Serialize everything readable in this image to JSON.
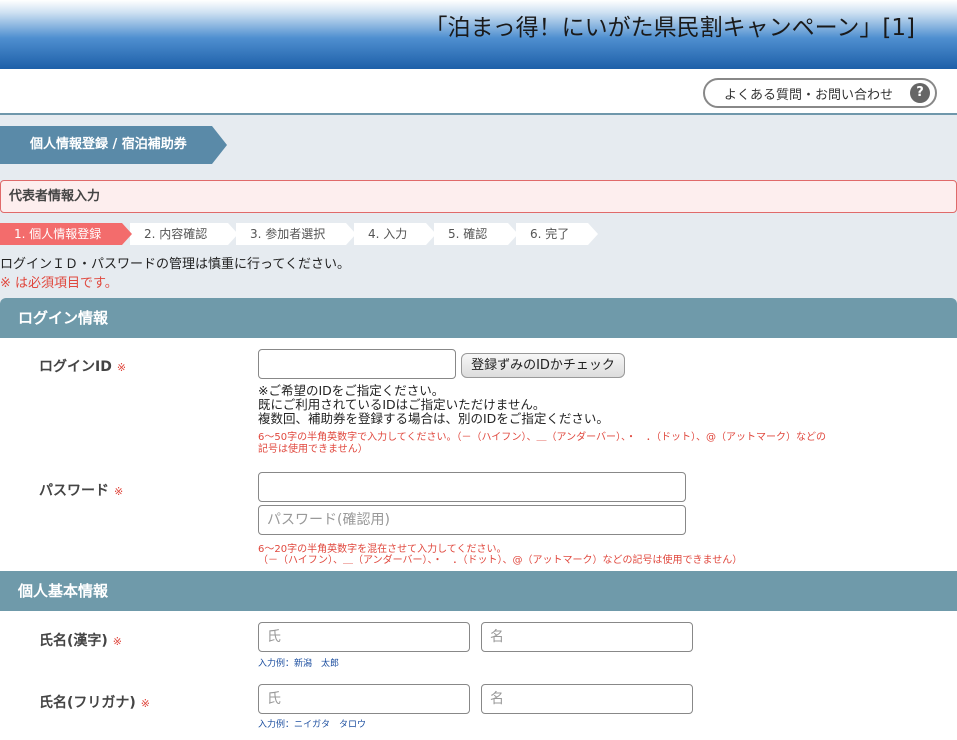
{
  "header": {
    "title": "「泊まっ得！にいがた県民割キャンペーン」[1]"
  },
  "topbar": {
    "faq_label": "よくある質問・お問い合わせ",
    "faq_icon": "?"
  },
  "section": {
    "tag": "個人情報登録 / 宿泊補助券",
    "rep_box": "代表者情報入力"
  },
  "steps": [
    {
      "label": "1. 個人情報登録"
    },
    {
      "label": "2. 内容確認"
    },
    {
      "label": "3. 参加者選択"
    },
    {
      "label": "4. 入力"
    },
    {
      "label": "5. 確認"
    },
    {
      "label": "6. 完了"
    }
  ],
  "notes": {
    "caution": "ログインＩＤ・パスワードの管理は慎重に行ってください。",
    "required": "※ は必須項目です。"
  },
  "login": {
    "band": "ログイン情報",
    "id_label": "ログインID",
    "required_mark": "※",
    "id_value": "",
    "check_button": "登録ずみのIDかチェック",
    "id_hint_1": "※ご希望のIDをご指定ください。",
    "id_hint_2": "既にご利用されているIDはご指定いただけません。",
    "id_hint_3": "複数回、補助券を登録する場合は、別のIDをご指定ください。",
    "id_rule_1": "6～50字の半角英数字で入力してください。（－（ハイフン）、＿（アンダーバー）、・　．（ドット）、@（アットマーク）などの",
    "id_rule_2": "記号は使用できません）",
    "pw_label": "パスワード",
    "pw_value": "",
    "pw_confirm_placeholder": "パスワード(確認用)",
    "pw_rule_1": "6～20字の半角英数字を混在させて入力してください。",
    "pw_rule_2": "（－（ハイフン）、＿（アンダーバー）、・　．（ドット）、@（アットマーク）などの記号は使用できません）"
  },
  "personal": {
    "band": "個人基本情報",
    "kanji_label": "氏名(漢字)",
    "kana_label": "氏名(フリガナ)",
    "surname_placeholder": "氏",
    "given_placeholder": "名",
    "kanji_example": "入力例：新潟　太郎",
    "kana_example": "入力例：ニイガタ　タロウ"
  }
}
